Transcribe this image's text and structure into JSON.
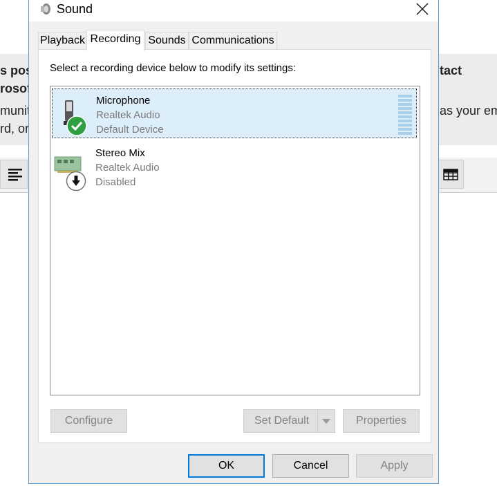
{
  "background": {
    "left_top_text": "s post",
    "left_second_text": "rosoft",
    "left_third_text": "munity",
    "left_fourth_text": "rd, or",
    "right_top_text": "tact",
    "right_mid_text": "as your em"
  },
  "dialog": {
    "title": "Sound",
    "tabs": [
      {
        "label": "Playback"
      },
      {
        "label": "Recording"
      },
      {
        "label": "Sounds"
      },
      {
        "label": "Communications"
      }
    ],
    "instruction": "Select a recording device below to modify its settings:",
    "devices": [
      {
        "name": "Microphone",
        "driver": "Realtek Audio",
        "status": "Default Device"
      },
      {
        "name": "Stereo Mix",
        "driver": "Realtek Audio",
        "status": "Disabled"
      }
    ],
    "buttons": {
      "configure": "Configure",
      "set_default": "Set Default",
      "properties": "Properties",
      "ok": "OK",
      "cancel": "Cancel",
      "apply": "Apply"
    }
  },
  "colors": {
    "accent": "#0078d7",
    "selection": "#dceefa",
    "default_check": "#2ea043"
  }
}
